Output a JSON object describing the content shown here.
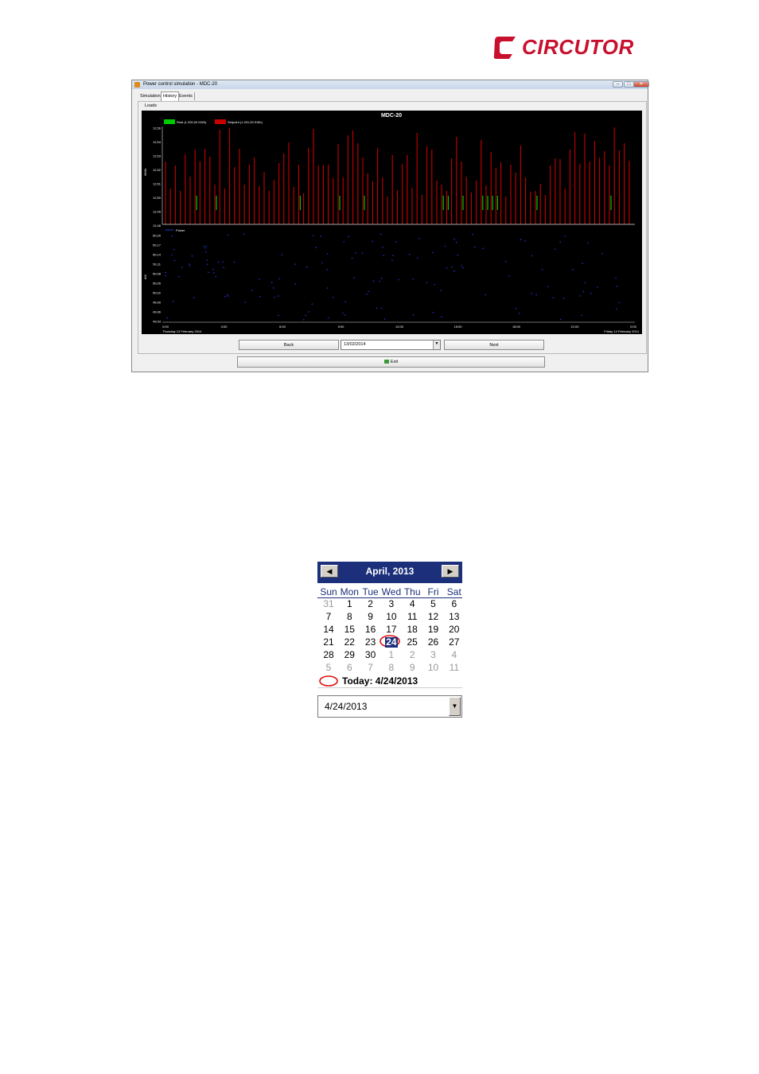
{
  "logo": {
    "brand": "CIRCUTOR"
  },
  "window": {
    "title": "Power control simulation - MDC-20",
    "tabs": [
      "Simulation",
      "History",
      "Events"
    ],
    "active_tab": "History",
    "panel_label": "Loads"
  },
  "chart_data": [
    {
      "type": "bar",
      "title": "MDC-20",
      "ylabel": "MWh",
      "series": [
        {
          "name": "Real (1.200,00 KWh)",
          "color": "#00c800"
        },
        {
          "name": "Setpoint (1.201,00 KWh)",
          "color": "#c80000"
        }
      ],
      "yticks": [
        "12,56",
        "12,54",
        "12,53",
        "12,52",
        "12,51",
        "12,50",
        "12,49",
        "12,48"
      ],
      "ylim": [
        12.48,
        12.56
      ]
    },
    {
      "type": "scatter",
      "ylabel": "kW",
      "series": [
        {
          "name": "Power",
          "color": "#2233cc"
        }
      ],
      "yticks": [
        "50,20",
        "50,17",
        "50,14",
        "50,11",
        "50,08",
        "50,05",
        "50,02",
        "49,99",
        "49,96",
        "49,93"
      ],
      "xticks": [
        "0:00",
        "3:00",
        "6:00",
        "9:00",
        "12:00",
        "15:00",
        "18:00",
        "21:00",
        "0:00"
      ],
      "x_start_label": "Thursday 13 February 2014",
      "x_end_label": "Friday 14 February 2014"
    }
  ],
  "controls": {
    "back_label": "Back",
    "next_label": "Next",
    "date_value": "13/02/2014",
    "exit_label": "Exit"
  },
  "calendar": {
    "month_title": "April, 2013",
    "dow": [
      "Sun",
      "Mon",
      "Tue",
      "Wed",
      "Thu",
      "Fri",
      "Sat"
    ],
    "weeks": [
      [
        "31",
        "1",
        "2",
        "3",
        "4",
        "5",
        "6"
      ],
      [
        "7",
        "8",
        "9",
        "10",
        "11",
        "12",
        "13"
      ],
      [
        "14",
        "15",
        "16",
        "17",
        "18",
        "19",
        "20"
      ],
      [
        "21",
        "22",
        "23",
        "24",
        "25",
        "26",
        "27"
      ],
      [
        "28",
        "29",
        "30",
        "1",
        "2",
        "3",
        "4"
      ],
      [
        "5",
        "6",
        "7",
        "8",
        "9",
        "10",
        "11"
      ]
    ],
    "selected": "24",
    "today_text": "Today: 4/24/2013",
    "combo_value": "4/24/2013"
  }
}
